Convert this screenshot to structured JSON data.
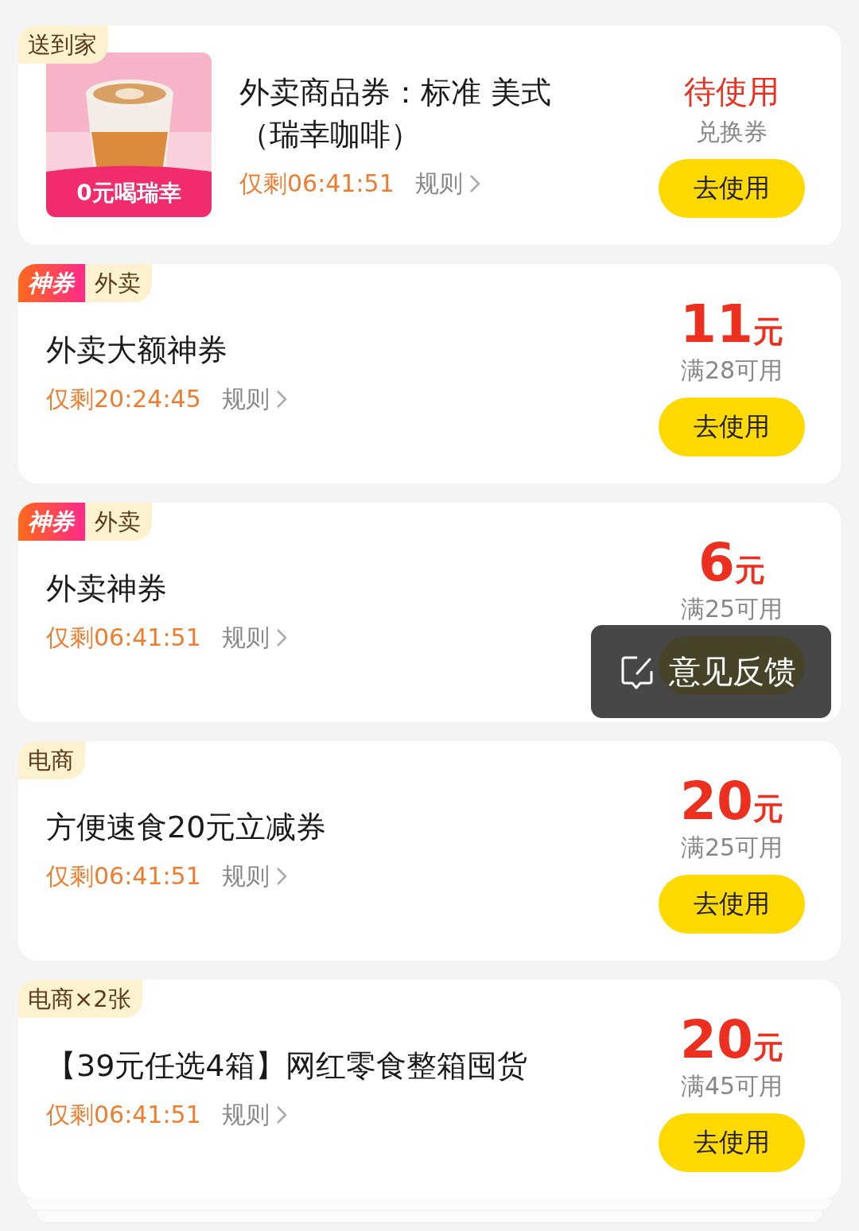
{
  "coupons": [
    {
      "kind": "product",
      "tags": [
        {
          "kind": "plain",
          "label": "送到家"
        }
      ],
      "picture": {
        "kind": "picture",
        "caption": "0元喝瑞幸"
      },
      "title": "外卖商品券：标准 美式（瑞幸咖啡）",
      "timer": "仅剩06:41:51",
      "rules": "规则",
      "status": "待使用",
      "note": "兑换券",
      "button": "去使用"
    },
    {
      "kind": "amount",
      "tags": [
        {
          "kind": "hot",
          "label": "神券"
        },
        {
          "kind": "plain",
          "label": "外卖"
        }
      ],
      "title": "外卖大额神券",
      "timer": "仅剩20:24:45",
      "rules": "规则",
      "amount": "11",
      "unit": "元",
      "note": "满28可用",
      "button": "去使用"
    },
    {
      "kind": "amount",
      "tags": [
        {
          "kind": "hot",
          "label": "神券"
        },
        {
          "kind": "plain",
          "label": "外卖"
        }
      ],
      "title": "外卖神券",
      "timer": "仅剩06:41:51",
      "rules": "规则",
      "amount": "6",
      "unit": "元",
      "note": "满25可用"
    },
    {
      "kind": "amount",
      "tags": [
        {
          "kind": "plain",
          "label": "电商"
        }
      ],
      "title": "方便速食20元立减券",
      "timer": "仅剩06:41:51",
      "rules": "规则",
      "amount": "20",
      "unit": "元",
      "note": "满25可用",
      "button": "去使用"
    },
    {
      "kind": "amount",
      "stacked": true,
      "tags": [
        {
          "kind": "plain",
          "label": "电商×2张"
        }
      ],
      "title": "【39元任选4箱】网红零食整箱囤货",
      "timer": "仅剩06:41:51",
      "rules": "规则",
      "amount": "20",
      "unit": "元",
      "note": "满45可用",
      "button": "去使用"
    }
  ],
  "feedback_popup": {
    "label": "意见反馈"
  }
}
